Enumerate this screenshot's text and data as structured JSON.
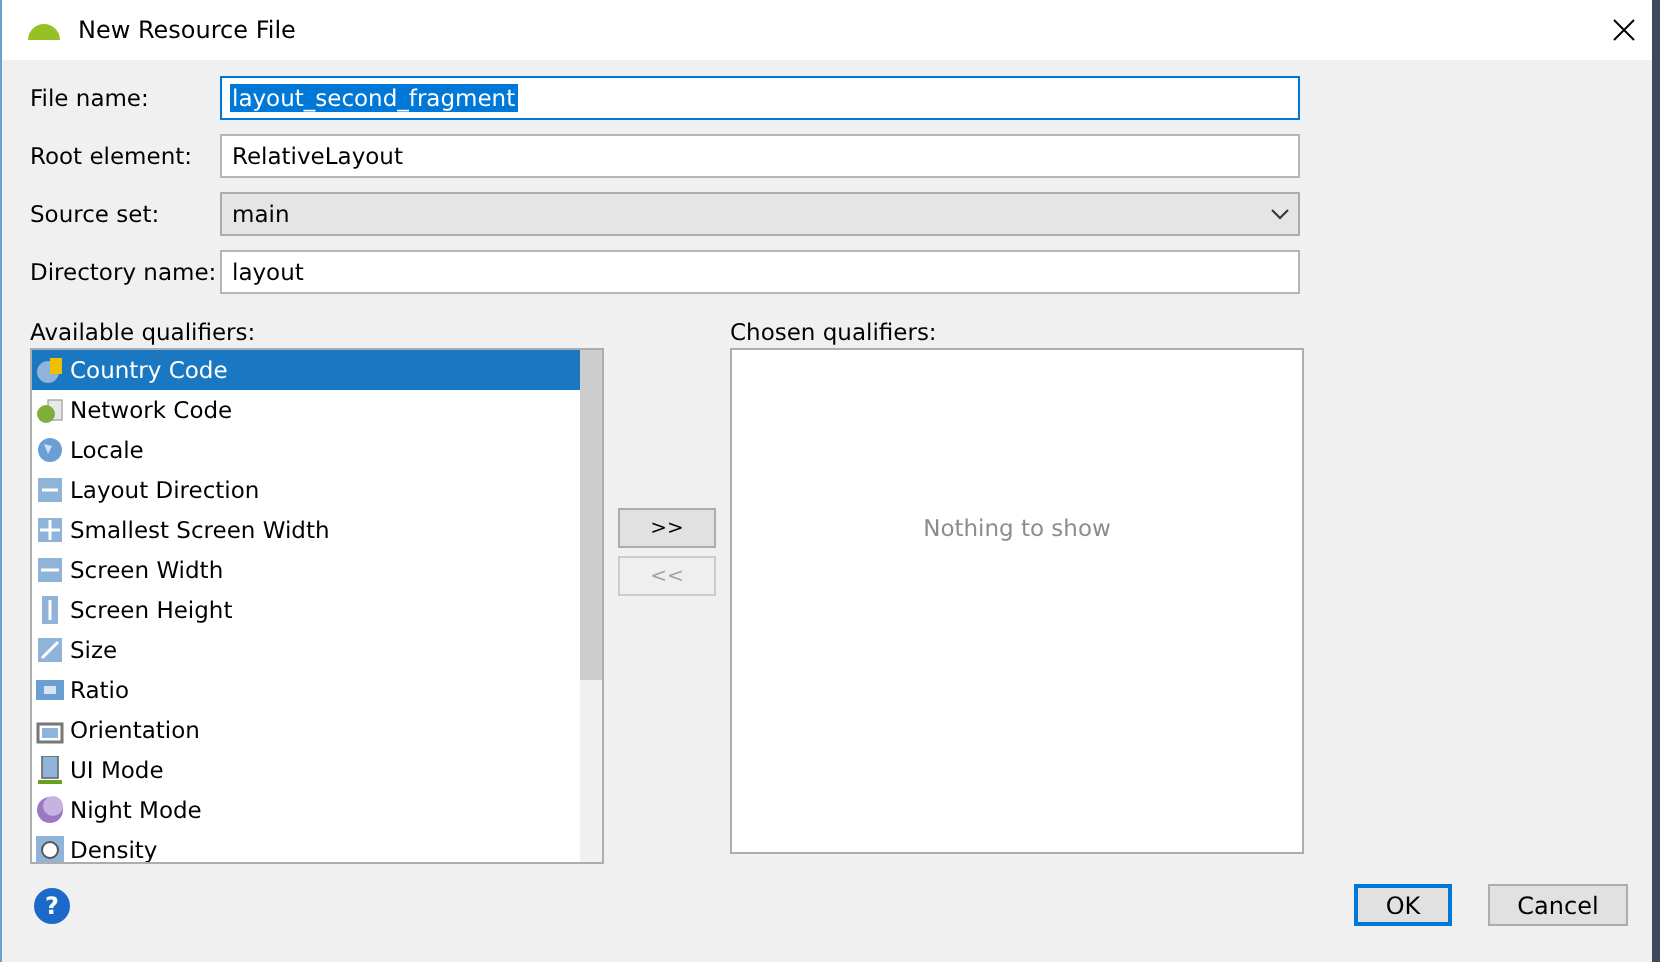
{
  "window": {
    "title": "New Resource File"
  },
  "fields": [
    {
      "label": "File name:",
      "kind": "text",
      "value": "layout_second_fragment",
      "focused": true
    },
    {
      "label": "Root element:",
      "kind": "text",
      "value": "RelativeLayout",
      "focused": false
    },
    {
      "label": "Source set:",
      "kind": "select",
      "value": "main",
      "focused": false
    },
    {
      "label": "Directory name:",
      "kind": "text",
      "value": "layout",
      "focused": false
    }
  ],
  "available": {
    "label": "Available qualifiers:",
    "items": [
      {
        "label": "Country Code",
        "selected": true
      },
      {
        "label": "Network Code",
        "selected": false
      },
      {
        "label": "Locale",
        "selected": false
      },
      {
        "label": "Layout Direction",
        "selected": false
      },
      {
        "label": "Smallest Screen Width",
        "selected": false
      },
      {
        "label": "Screen Width",
        "selected": false
      },
      {
        "label": "Screen Height",
        "selected": false
      },
      {
        "label": "Size",
        "selected": false
      },
      {
        "label": "Ratio",
        "selected": false
      },
      {
        "label": "Orientation",
        "selected": false
      },
      {
        "label": "UI Mode",
        "selected": false
      },
      {
        "label": "Night Mode",
        "selected": false
      },
      {
        "label": "Density",
        "selected": false
      }
    ]
  },
  "move_buttons": [
    {
      "label": ">>",
      "disabled": false
    },
    {
      "label": "<<",
      "disabled": true
    }
  ],
  "chosen": {
    "label": "Chosen qualifiers:",
    "empty_text": "Nothing to show"
  },
  "help": "?",
  "buttons": [
    {
      "label": "OK",
      "default": true
    },
    {
      "label": "Cancel",
      "default": false
    }
  ]
}
